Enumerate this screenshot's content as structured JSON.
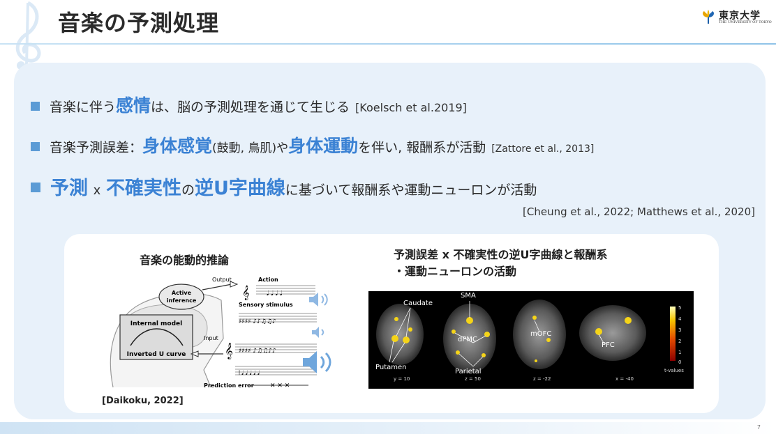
{
  "header": {
    "title": "音楽の予測処理",
    "logo": {
      "name": "東京大学",
      "sub": "THE UNIVERSITY OF TOKYO"
    }
  },
  "bullets": [
    {
      "pre": "音楽に伴う",
      "emph": "感情",
      "post": "は、脳の予測処理を通じて生じる",
      "cite": "[Koelsch et al.2019]"
    },
    {
      "pre": "音楽予測誤差：",
      "emph1": "身体感覚",
      "mid1": "(鼓動, 鳥肌)や",
      "emph2": "身体運動",
      "mid2": "を伴い, 報酬系が活動",
      "cite": "[Zattore et al., 2013]"
    },
    {
      "emph1": "予測",
      "sep": "x",
      "emph2": "不確実性",
      "mid1": "の",
      "emph3": "逆U字曲線",
      "post": "に基づいて報酬系や運動ニューロンが活動"
    }
  ],
  "citation_line": "[Cheung et al., 2022; Matthews et al., 2020]",
  "card": {
    "left_title": "音楽の能動的推論",
    "right_title_line1": "予測誤差 x 不確実性の逆U字曲線と報酬系",
    "right_title_line2": "・運動ニューロンの活動",
    "figure_citation": "[Daikoku, 2022]",
    "diagram": {
      "output": "Output",
      "action": "Action",
      "active_inference_1": "Active",
      "active_inference_2": "inference",
      "sensory_stimulus": "Sensory stimulus",
      "internal_model": "Internal model",
      "input": "Input",
      "inverted_u": "Inverted U curve",
      "prediction_error": "Prediction error"
    },
    "brain": {
      "caudate": "Caudate",
      "putamen": "Putamen",
      "sma": "SMA",
      "dpmc": "dPMC",
      "parietal": "Parietal",
      "mofc": "mOFC",
      "pfc": "PFC",
      "y10": "y = 10",
      "z50": "z = 50",
      "z22": "z = -22",
      "x40": "x = -40",
      "scale_max": "5",
      "scale_4": "4",
      "scale_3": "3",
      "scale_2": "2",
      "scale_1": "1",
      "scale_0": "0",
      "scale_label": "t-values"
    }
  },
  "page_number": "7",
  "colors": {
    "accent": "#3b82d4",
    "bullet": "#5b9bd5",
    "panel": "#e8f1fa"
  }
}
